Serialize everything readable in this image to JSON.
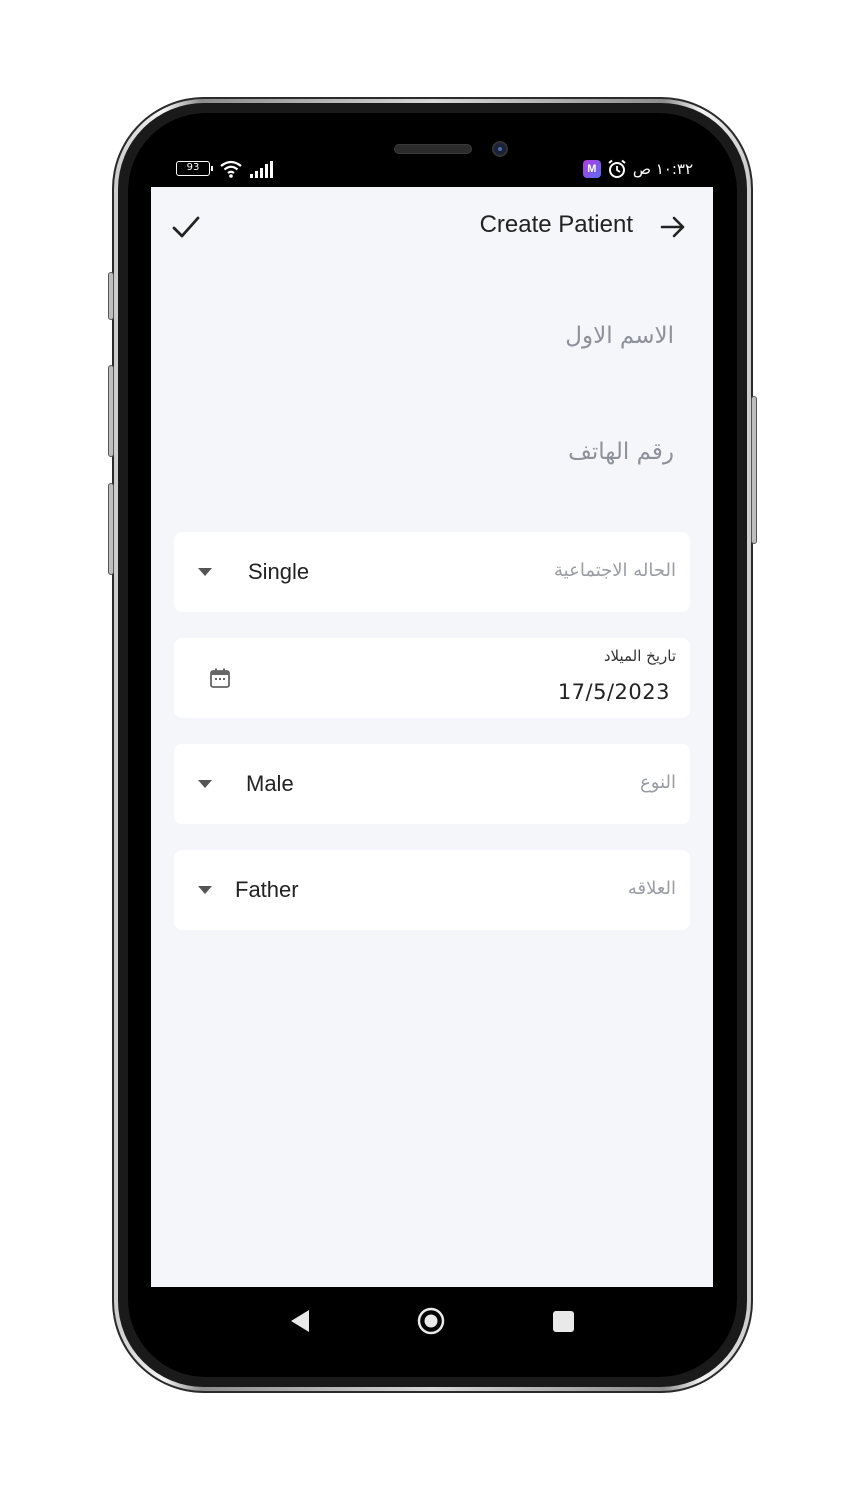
{
  "status_bar": {
    "battery_level": "93",
    "time": "١٠:٣٢ ص",
    "app_badge": "M"
  },
  "app_bar": {
    "title": "Create Patient"
  },
  "form": {
    "first_name_placeholder": "الاسم الاول",
    "phone_placeholder": "رقم الهاتف",
    "marital_status": {
      "label": "الحاله الاجتماعية",
      "value": "Single"
    },
    "birth_date": {
      "label": "تاريخ الميلاد",
      "value": "17/5/2023"
    },
    "gender": {
      "label": "النوع",
      "value": "Male"
    },
    "relation": {
      "label": "العلاقه",
      "value": "Father"
    }
  },
  "colors": {
    "screen_background": "#f4f6fa",
    "card_background": "#ffffff",
    "placeholder_text": "#8e9199",
    "primary_text": "#222222"
  },
  "icons": [
    "check-icon",
    "arrow-right-icon",
    "dropdown-caret-icon",
    "calendar-icon",
    "wifi-icon",
    "signal-icon",
    "alarm-icon",
    "nav-back-icon",
    "nav-home-icon",
    "nav-recents-icon"
  ]
}
